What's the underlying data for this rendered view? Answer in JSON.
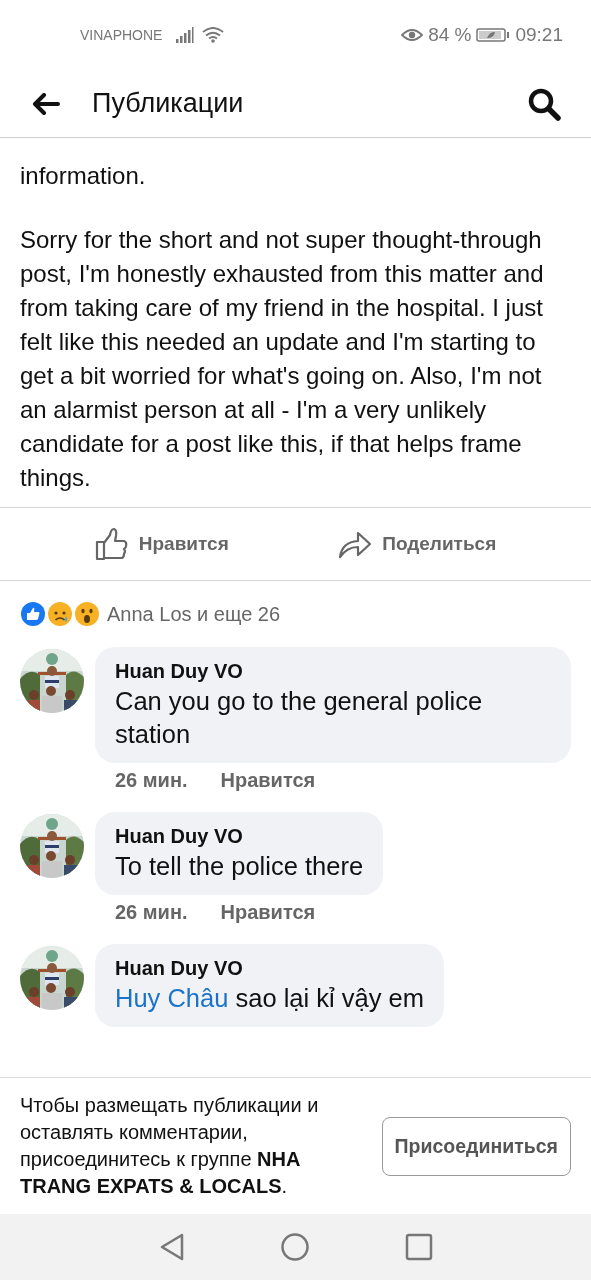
{
  "status_bar": {
    "carrier": "VINAPHONE",
    "battery_percent": "84 %",
    "time": "09:21"
  },
  "header": {
    "title": "Публикации"
  },
  "post": {
    "paragraphs": [
      "information.",
      "Sorry for the short and not super thought-through post, I'm honestly exhausted from this matter and from taking care of my friend in the hospital. I just felt like this needed an update and I'm starting to get a bit worried for what's going on. Also, I'm not an alarmist person at all - I'm a very unlikely candidate for a post like this, if that helps frame things."
    ],
    "actions": [
      {
        "kind": "like",
        "label": "Нравится"
      },
      {
        "kind": "share",
        "label": "Поделиться"
      }
    ],
    "reactions": {
      "icons": [
        {
          "kind": "like"
        },
        {
          "kind": "sad"
        },
        {
          "kind": "wow"
        }
      ],
      "summary": "Anna Los и еще 26"
    }
  },
  "comments": [
    {
      "author": "Huan Duy VO",
      "text": "Can you go to the general police station",
      "time": "26 мин.",
      "like": "Нравится"
    },
    {
      "author": "Huan Duy VO",
      "text": "To tell the police there",
      "time": "26 мин.",
      "like": "Нравится"
    },
    {
      "author": "Huan Duy VO",
      "mention": "Huy Châu",
      "text": "sao lại kỉ vậy em"
    }
  ],
  "join_bar": {
    "message": "Чтобы размещать публикации и оставлять комментарии, присоединитесь к группе **NHA TRANG EXPATS & LOCALS**.",
    "button": "Присоединиться"
  }
}
